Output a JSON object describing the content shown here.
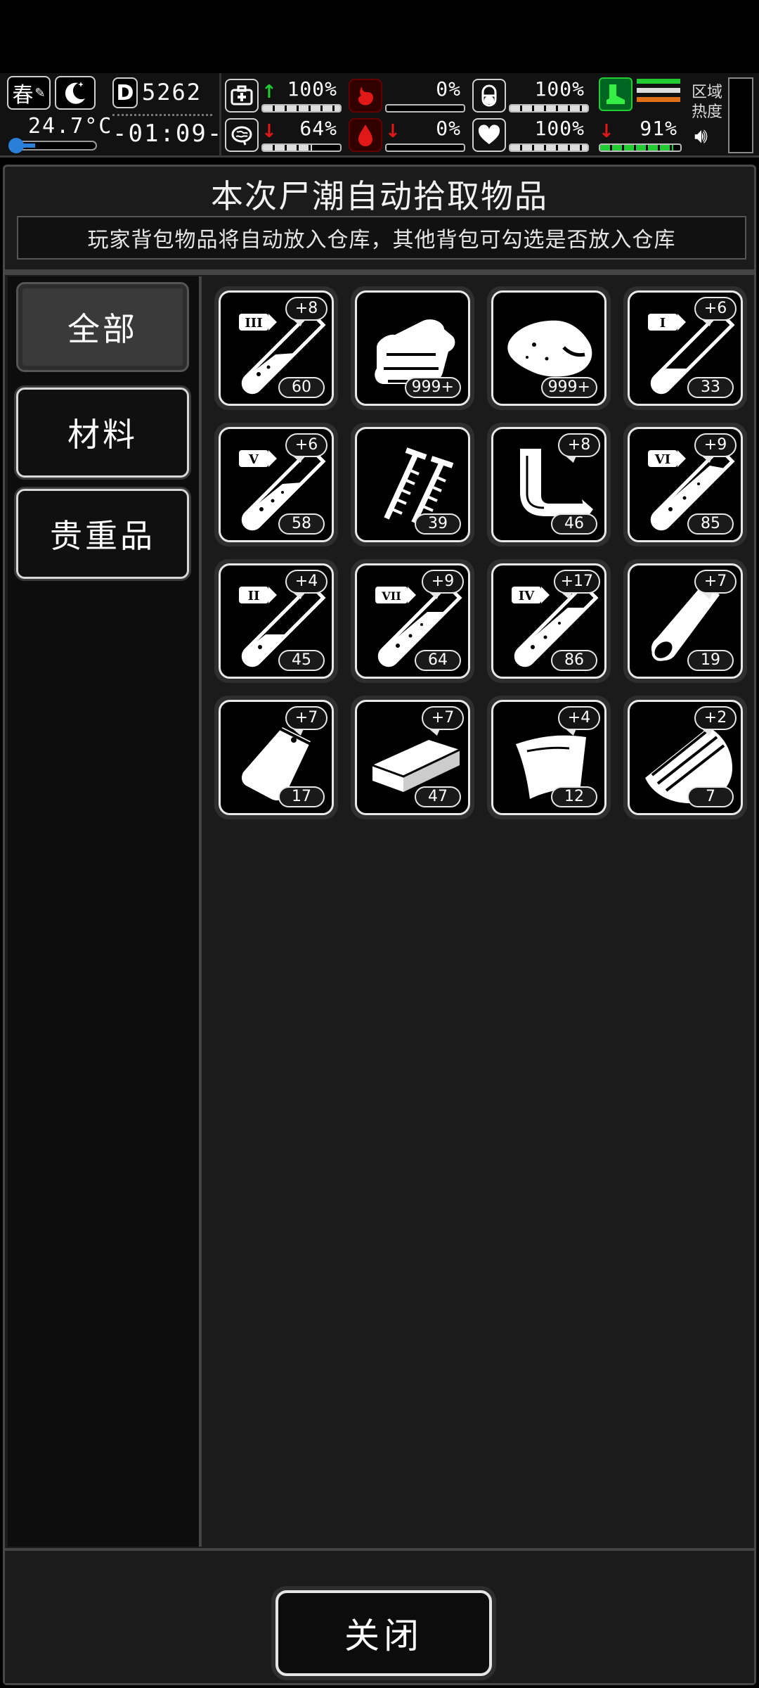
{
  "status": {
    "season": "春",
    "temperature": "24.7°C",
    "day_letter": "D",
    "day_number": "5262",
    "time": "-01:09-",
    "zone_heat_label_line1": "区域",
    "zone_heat_label_line2": "热度",
    "stats": [
      {
        "name": "health",
        "icon": "medkit-icon",
        "trend": "up",
        "percent": "100%",
        "level": 1.0
      },
      {
        "name": "hunger",
        "icon": "stomach-icon",
        "trend": "none",
        "percent": "0%",
        "level": 0.0
      },
      {
        "name": "pill",
        "icon": "pill-icon",
        "trend": "none",
        "percent": "100%",
        "level": 1.0
      },
      {
        "name": "sanity",
        "icon": "brain-icon",
        "trend": "down",
        "percent": "64%",
        "level": 0.64
      },
      {
        "name": "thirst",
        "icon": "water-drop-icon",
        "trend": "down",
        "percent": "0%",
        "level": 0.0
      },
      {
        "name": "mood",
        "icon": "heart-icon",
        "trend": "none",
        "percent": "100%",
        "level": 1.0
      },
      {
        "name": "stamina",
        "icon": "boot-icon",
        "trend": "down",
        "percent": "91%",
        "level": 0.91
      }
    ],
    "colors": {
      "up": "#22cc33",
      "down": "#e01818",
      "stamina_fill": "#22cc33"
    }
  },
  "panel": {
    "title": "本次尸潮自动拾取物品",
    "subtitle": "玩家背包物品将自动放入仓库，其他背包可勾选是否放入仓库"
  },
  "tabs": [
    {
      "label": "全部",
      "active": true
    },
    {
      "label": "材料",
      "active": false
    },
    {
      "label": "贵重品",
      "active": false
    }
  ],
  "items": [
    {
      "icon": "test-tube-iii-icon",
      "count": "60",
      "bonus": "+8"
    },
    {
      "icon": "cloth-icon",
      "count": "999+",
      "bonus": ""
    },
    {
      "icon": "meat-icon",
      "count": "999+",
      "bonus": ""
    },
    {
      "icon": "test-tube-i-icon",
      "count": "33",
      "bonus": "+6"
    },
    {
      "icon": "test-tube-v-icon",
      "count": "58",
      "bonus": "+6"
    },
    {
      "icon": "screws-icon",
      "count": "39",
      "bonus": ""
    },
    {
      "icon": "bent-pipe-icon",
      "count": "46",
      "bonus": "+8"
    },
    {
      "icon": "test-tube-vi-icon",
      "count": "85",
      "bonus": "+9"
    },
    {
      "icon": "test-tube-ii-icon",
      "count": "45",
      "bonus": "+4"
    },
    {
      "icon": "test-tube-vii-icon",
      "count": "64",
      "bonus": "+9"
    },
    {
      "icon": "test-tube-iv-icon",
      "count": "86",
      "bonus": "+17"
    },
    {
      "icon": "wood-log-icon",
      "count": "19",
      "bonus": "+7"
    },
    {
      "icon": "bag-icon",
      "count": "17",
      "bonus": "+7"
    },
    {
      "icon": "brick-icon",
      "count": "47",
      "bonus": "+7"
    },
    {
      "icon": "leather-sheet-icon",
      "count": "12",
      "bonus": "+4"
    },
    {
      "icon": "wood-planks-icon",
      "count": "7",
      "bonus": "+2"
    }
  ],
  "close_label": "关闭"
}
